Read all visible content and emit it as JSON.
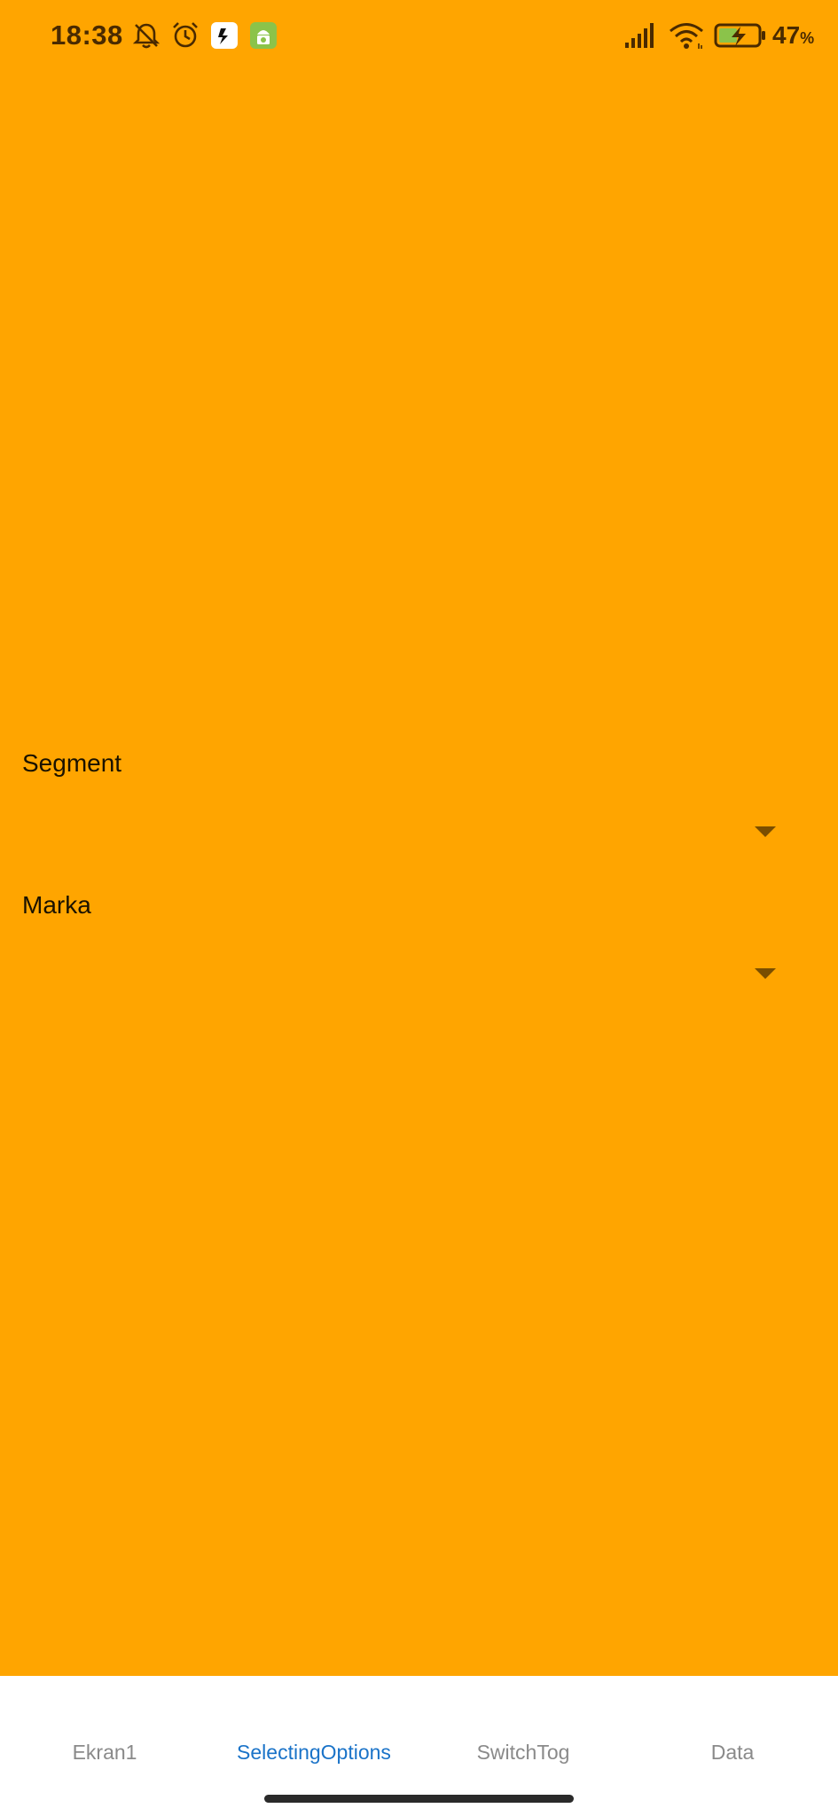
{
  "status_bar": {
    "time": "18:38",
    "battery_level": "47",
    "battery_unit": "%",
    "left_icons": [
      "bell-off-icon",
      "alarm-icon",
      "app-notification-icon",
      "android-app-icon"
    ],
    "right_icons": [
      "signal-icon",
      "wifi-icon",
      "battery-charging-icon"
    ],
    "icon_color": "#4a2a00"
  },
  "main": {
    "background_color": "#FFA500",
    "fields": [
      {
        "label": "Segment",
        "value": ""
      },
      {
        "label": "Marka",
        "value": ""
      }
    ]
  },
  "bottom_nav": {
    "tabs": [
      {
        "label": "Ekran1",
        "active": false
      },
      {
        "label": "SelectingOptions",
        "active": true
      },
      {
        "label": "SwitchTog",
        "active": false
      },
      {
        "label": "Data",
        "active": false
      }
    ],
    "active_color": "#1a73c8",
    "inactive_color": "#8a8a8a"
  }
}
